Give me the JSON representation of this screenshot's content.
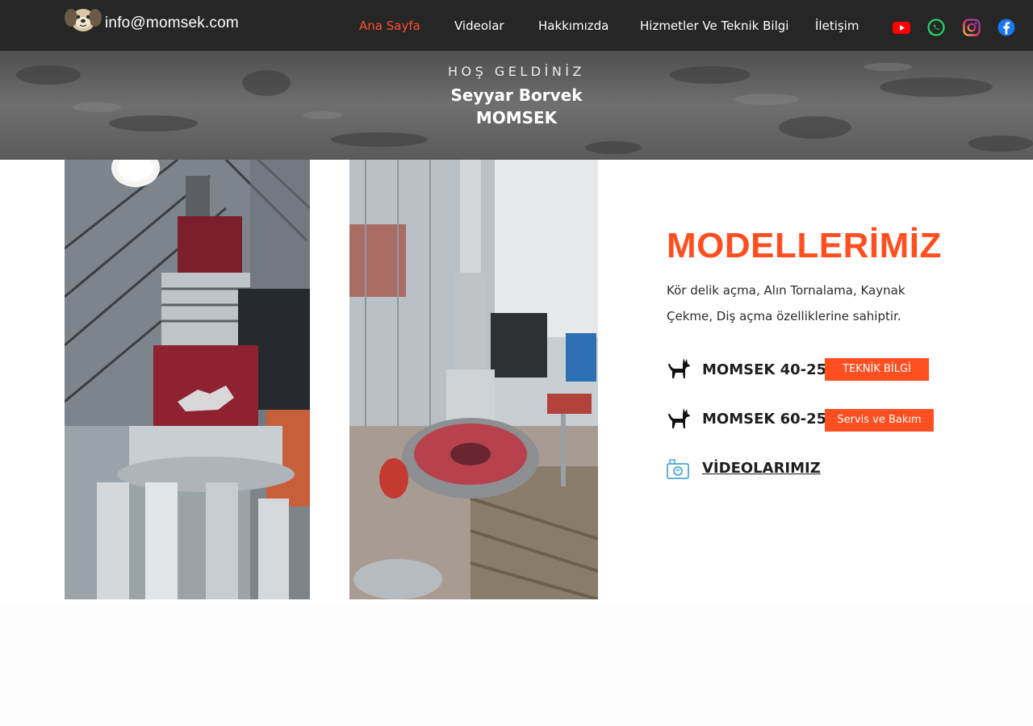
{
  "header": {
    "email": "info@momsek.com",
    "nav": [
      {
        "label": "Ana Sayfa",
        "active": true
      },
      {
        "label": "Videolar",
        "active": false
      },
      {
        "label": "Hakkımızda",
        "active": false
      },
      {
        "label": "Hizmetler Ve Teknik Bilgi",
        "active": false
      },
      {
        "label": "İletişim",
        "active": false
      }
    ],
    "social_icons": [
      "youtube-icon",
      "whatsapp-icon",
      "instagram-icon",
      "facebook-icon"
    ]
  },
  "hero": {
    "kicker": "HOŞ GELDİNİZ",
    "title_line1": "Seyyar Borvek",
    "title_line2": "MOMSEK"
  },
  "models": {
    "title": "MODELLERİMİZ",
    "description": "Kör delik açma, Alın Tornalama, Kaynak Çekme, Diş açma özelliklerine sahiptir.",
    "items": [
      {
        "name": "MOMSEK 40-25",
        "button": "TEKNİK BİLGİ"
      },
      {
        "name": "MOMSEK 60-25",
        "button": "Servis ve Bakım"
      }
    ],
    "videos_link": "VİDEOLARIMIZ"
  },
  "colors": {
    "accent": "#ff4f21",
    "nav_bg": "#262626",
    "active_nav": "#ff4f2b"
  }
}
